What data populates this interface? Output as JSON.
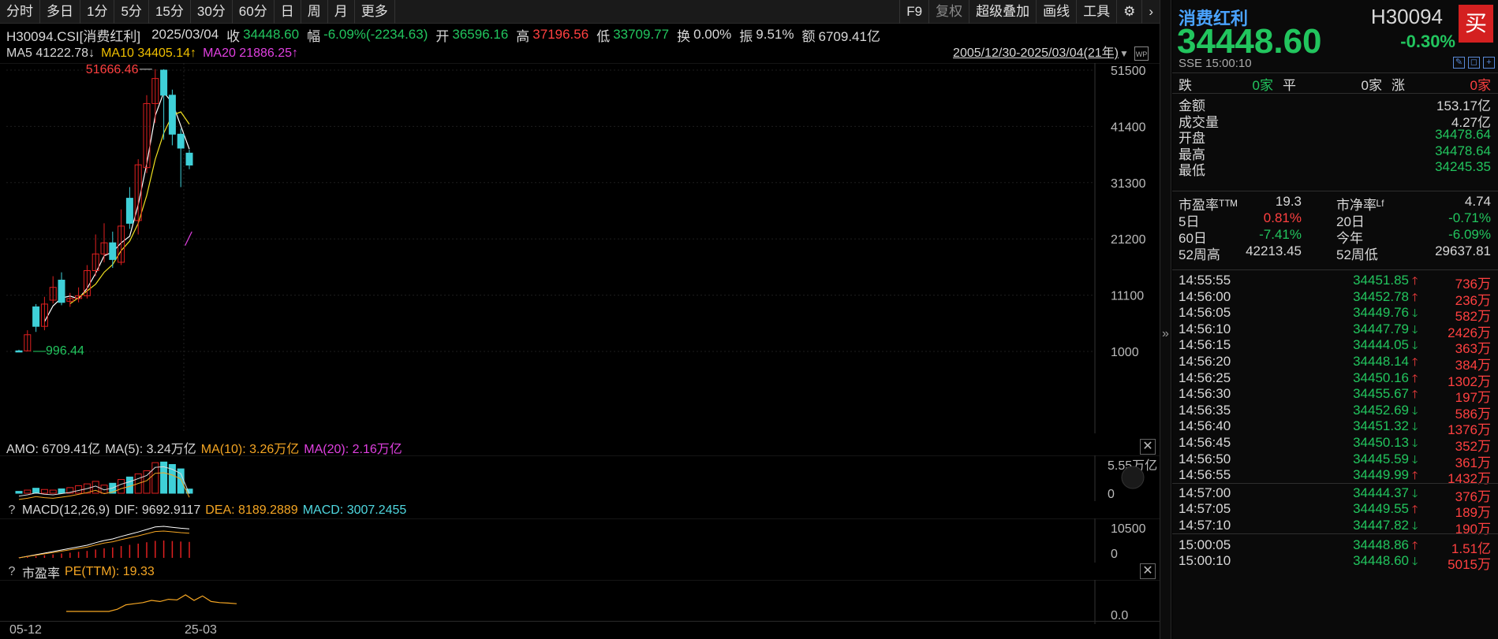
{
  "toolbar": {
    "left_items": [
      "分时",
      "多日",
      "1分",
      "5分",
      "15分",
      "30分",
      "60分",
      "日",
      "周",
      "月",
      "更多"
    ],
    "f9": "F9",
    "fuquan": "复权",
    "overlay": "超级叠加",
    "draw": "画线",
    "tools": "工具",
    "gear": "⚙",
    "next": "›"
  },
  "quote": {
    "symbol": "H30094.CSI[消费红利]",
    "date": "2025/03/04",
    "close_label": "收",
    "close": "34448.60",
    "change_label": "幅",
    "change": "-6.09%(-2234.63)",
    "open_label": "开",
    "open": "36596.16",
    "high_label": "高",
    "high": "37196.56",
    "low_label": "低",
    "low": "33709.77",
    "turnover_label": "换",
    "turnover": "0.00%",
    "amplitude_label": "振",
    "amplitude": "9.51%",
    "amount_label": "额",
    "amount": "6709.41亿"
  },
  "ma": {
    "ma5": "MA5 41222.78↓",
    "ma10": "MA10 34405.14↑",
    "ma20": "MA20 21886.25↑",
    "range": "2005/12/30-2025/03/04(21年)"
  },
  "main_axis": [
    "51500",
    "41400",
    "31300",
    "21200",
    "11100",
    "1000"
  ],
  "main_annotations": {
    "max": "51666.46",
    "min": "996.44"
  },
  "amo": {
    "label": "AMO: 6709.41亿",
    "ma5": "MA(5): 3.24万亿",
    "ma10": "MA(10): 3.26万亿",
    "ma20": "MA(20): 2.16万亿",
    "axis_top": "5.55万亿",
    "axis_bottom": "0"
  },
  "macd": {
    "q": "?",
    "label": "MACD(12,26,9)",
    "dif": "DIF: 9692.9117",
    "dea": "DEA: 8189.2889",
    "macd": "MACD: 3007.2455",
    "axis_top": "10500",
    "axis_bottom": "0"
  },
  "pe": {
    "q": "?",
    "label": "市盈率",
    "value": "PE(TTM): 19.33",
    "axis": "0.0"
  },
  "x_axis": {
    "start": "05-12",
    "end": "25-03"
  },
  "chart_data": {
    "type": "candlestick",
    "range": "2005/12/30-2025/03/04",
    "ylim": [
      1000,
      51500
    ],
    "candles": [
      {
        "o": 1100,
        "c": 996,
        "h": 1300,
        "l": 996
      },
      {
        "o": 1100,
        "c": 4000,
        "h": 4800,
        "l": 1000
      },
      {
        "o": 9000,
        "c": 5500,
        "h": 9500,
        "l": 4500
      },
      {
        "o": 5500,
        "c": 9500,
        "h": 10800,
        "l": 4800
      },
      {
        "o": 10200,
        "c": 12500,
        "h": 14500,
        "l": 9600
      },
      {
        "o": 13800,
        "c": 9800,
        "h": 15200,
        "l": 9300
      },
      {
        "o": 10000,
        "c": 10500,
        "h": 11500,
        "l": 9000
      },
      {
        "o": 10500,
        "c": 11000,
        "h": 12500,
        "l": 9800
      },
      {
        "o": 11000,
        "c": 15500,
        "h": 16500,
        "l": 10500
      },
      {
        "o": 15500,
        "c": 18500,
        "h": 22000,
        "l": 14500
      },
      {
        "o": 18500,
        "c": 20500,
        "h": 24000,
        "l": 17000
      },
      {
        "o": 20500,
        "c": 17500,
        "h": 22500,
        "l": 16000
      },
      {
        "o": 17000,
        "c": 23500,
        "h": 26500,
        "l": 16500
      },
      {
        "o": 28500,
        "c": 24000,
        "h": 30500,
        "l": 23000
      },
      {
        "o": 24500,
        "c": 34500,
        "h": 35500,
        "l": 22000
      },
      {
        "o": 34000,
        "c": 45500,
        "h": 47000,
        "l": 33000
      },
      {
        "o": 45500,
        "c": 50000,
        "h": 51666,
        "l": 42000
      },
      {
        "o": 51500,
        "c": 47000,
        "h": 51666,
        "l": 39000
      },
      {
        "o": 47000,
        "c": 40000,
        "h": 48000,
        "l": 38000
      },
      {
        "o": 40000,
        "c": 37500,
        "h": 41000,
        "l": 30500
      },
      {
        "o": 36600,
        "c": 34449,
        "h": 37197,
        "l": 33710
      }
    ]
  },
  "right": {
    "name": "消费红利",
    "code": "H30094",
    "buy": "买",
    "price": "34448.60",
    "pct": "-0.30%",
    "exchange_time": "SSE  15:00:10",
    "breadth": {
      "down_label": "跌",
      "down": "0家",
      "flat_label": "平",
      "flat": "0家",
      "up_label": "涨",
      "up": "0家"
    },
    "stats": [
      {
        "label": "金额",
        "value": "153.17亿",
        "color": "#d8d8d8"
      },
      {
        "label": "成交量",
        "value": "4.27亿",
        "color": "#d8d8d8"
      },
      {
        "label": "开盘",
        "value": "34478.64",
        "color": "#22c55e"
      },
      {
        "label": "最高",
        "value": "34478.64",
        "color": "#22c55e"
      },
      {
        "label": "最低",
        "value": "34245.35",
        "color": "#22c55e"
      }
    ],
    "ratios": [
      {
        "l1": "市盈率ᵀᵀᴹ",
        "v1": "19.3",
        "c1": "#d8d8d8",
        "l2": "市净率ᴸᶠ",
        "v2": "4.74",
        "c2": "#d8d8d8"
      },
      {
        "l1": "5日",
        "v1": "0.81%",
        "c1": "#ff4040",
        "l2": "20日",
        "v2": "-0.71%",
        "c2": "#22c55e"
      },
      {
        "l1": "60日",
        "v1": "-7.41%",
        "c1": "#22c55e",
        "l2": "今年",
        "v2": "-6.09%",
        "c2": "#22c55e"
      },
      {
        "l1": "52周高",
        "v1": "42213.45",
        "c1": "#d8d8d8",
        "l2": "52周低",
        "v2": "29637.81",
        "c2": "#d8d8d8"
      }
    ],
    "ticks": [
      {
        "time": "14:55:55",
        "price": "34451.85",
        "dir": "up",
        "vol": "736万"
      },
      {
        "time": "14:56:00",
        "price": "34452.78",
        "dir": "up",
        "vol": "236万"
      },
      {
        "time": "14:56:05",
        "price": "34449.76",
        "dir": "down",
        "vol": "582万"
      },
      {
        "time": "14:56:10",
        "price": "34447.79",
        "dir": "down",
        "vol": "2426万"
      },
      {
        "time": "14:56:15",
        "price": "34444.05",
        "dir": "down",
        "vol": "363万"
      },
      {
        "time": "14:56:20",
        "price": "34448.14",
        "dir": "up",
        "vol": "384万"
      },
      {
        "time": "14:56:25",
        "price": "34450.16",
        "dir": "up",
        "vol": "1302万"
      },
      {
        "time": "14:56:30",
        "price": "34455.67",
        "dir": "up",
        "vol": "197万"
      },
      {
        "time": "14:56:35",
        "price": "34452.69",
        "dir": "down",
        "vol": "586万"
      },
      {
        "time": "14:56:40",
        "price": "34451.32",
        "dir": "down",
        "vol": "1376万"
      },
      {
        "time": "14:56:45",
        "price": "34450.13",
        "dir": "down",
        "vol": "352万"
      },
      {
        "time": "14:56:50",
        "price": "34445.59",
        "dir": "down",
        "vol": "361万"
      },
      {
        "time": "14:56:55",
        "price": "34449.99",
        "dir": "up",
        "vol": "1432万"
      },
      {
        "time": "14:57:00",
        "price": "34444.37",
        "dir": "down",
        "vol": "376万"
      },
      {
        "time": "14:57:05",
        "price": "34449.55",
        "dir": "up",
        "vol": "189万"
      },
      {
        "time": "14:57:10",
        "price": "34447.82",
        "dir": "down",
        "vol": "190万"
      },
      {
        "time": "15:00:05",
        "price": "34448.86",
        "dir": "up",
        "vol": "1.51亿"
      },
      {
        "time": "15:00:10",
        "price": "34448.60",
        "dir": "down",
        "vol": "5015万"
      }
    ]
  }
}
